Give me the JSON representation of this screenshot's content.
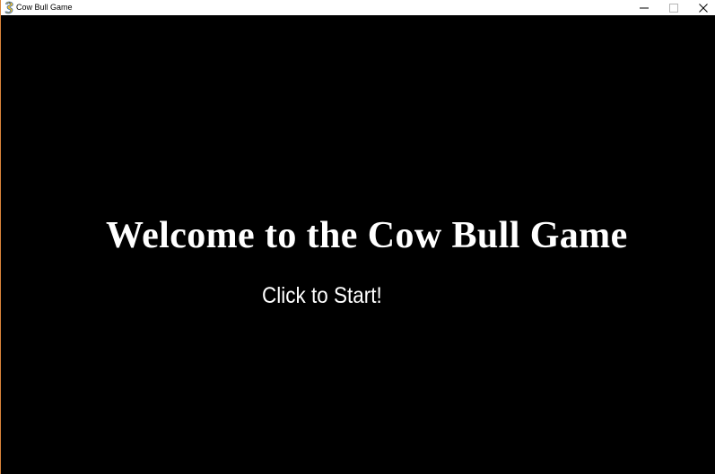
{
  "window": {
    "title": "Cow Bull Game",
    "icon": "pygame-snake-icon",
    "controls": {
      "minimize_icon": "minimize-icon",
      "maximize_icon": "maximize-icon",
      "close_icon": "close-icon"
    }
  },
  "screen": {
    "background": "#000000",
    "text_color": "#ffffff",
    "welcome_text": "Welcome to the Cow Bull Game",
    "start_prompt": "Click to Start!"
  }
}
